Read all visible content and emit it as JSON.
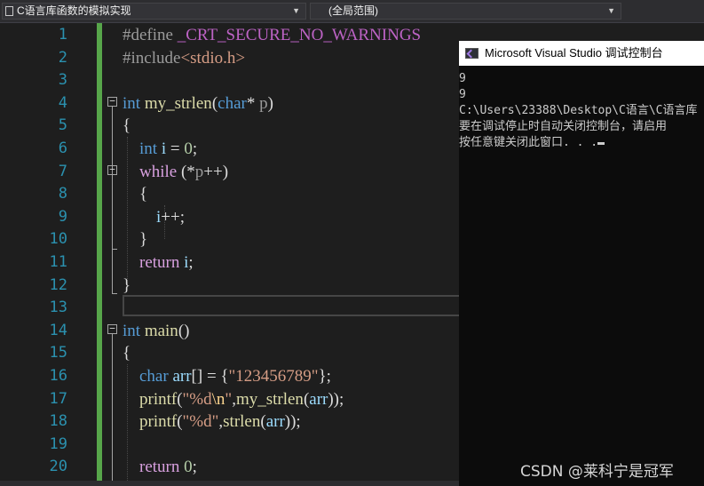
{
  "navbar": {
    "file_scope": "C语言库函数的模拟实现",
    "member_scope": "(全局范围)"
  },
  "editor": {
    "line_numbers": [
      "1",
      "2",
      "3",
      "4",
      "5",
      "6",
      "7",
      "8",
      "9",
      "10",
      "11",
      "12",
      "13",
      "14",
      "15",
      "16",
      "17",
      "18",
      "19",
      "20"
    ],
    "lines": [
      [
        {
          "t": "#define ",
          "c": "pp"
        },
        {
          "t": "_CRT_SECURE_NO_WARNINGS",
          "c": "macro"
        }
      ],
      [
        {
          "t": "#include",
          "c": "pp"
        },
        {
          "t": "<stdio.h>",
          "c": "str"
        }
      ],
      [],
      [
        {
          "t": "int",
          "c": "kw"
        },
        {
          "t": " "
        },
        {
          "t": "my_strlen",
          "c": "fn"
        },
        {
          "t": "("
        },
        {
          "t": "char",
          "c": "kw"
        },
        {
          "t": "* "
        },
        {
          "t": "p",
          "c": "param"
        },
        {
          "t": ")"
        }
      ],
      [
        {
          "t": "{"
        }
      ],
      [
        {
          "t": "    "
        },
        {
          "t": "int",
          "c": "kw"
        },
        {
          "t": " "
        },
        {
          "t": "i",
          "c": "var"
        },
        {
          "t": " = "
        },
        {
          "t": "0",
          "c": "num"
        },
        {
          "t": ";"
        }
      ],
      [
        {
          "t": "    "
        },
        {
          "t": "while",
          "c": "ctl"
        },
        {
          "t": " (*"
        },
        {
          "t": "p",
          "c": "param"
        },
        {
          "t": "++)"
        }
      ],
      [
        {
          "t": "    {"
        }
      ],
      [
        {
          "t": "        "
        },
        {
          "t": "i",
          "c": "var"
        },
        {
          "t": "++;"
        }
      ],
      [
        {
          "t": "    }"
        }
      ],
      [
        {
          "t": "    "
        },
        {
          "t": "return",
          "c": "ctl"
        },
        {
          "t": " "
        },
        {
          "t": "i",
          "c": "var"
        },
        {
          "t": ";"
        }
      ],
      [
        {
          "t": "}"
        }
      ],
      [],
      [
        {
          "t": "int",
          "c": "kw"
        },
        {
          "t": " "
        },
        {
          "t": "main",
          "c": "fn"
        },
        {
          "t": "()"
        }
      ],
      [
        {
          "t": "{"
        }
      ],
      [
        {
          "t": "    "
        },
        {
          "t": "char",
          "c": "kw"
        },
        {
          "t": " "
        },
        {
          "t": "arr",
          "c": "var"
        },
        {
          "t": "[] = {"
        },
        {
          "t": "\"123456789\"",
          "c": "str"
        },
        {
          "t": "};"
        }
      ],
      [
        {
          "t": "    "
        },
        {
          "t": "printf",
          "c": "fn"
        },
        {
          "t": "("
        },
        {
          "t": "\"%d",
          "c": "str"
        },
        {
          "t": "\\n",
          "c": "esc"
        },
        {
          "t": "\"",
          "c": "str"
        },
        {
          "t": ","
        },
        {
          "t": "my_strlen",
          "c": "fn"
        },
        {
          "t": "("
        },
        {
          "t": "arr",
          "c": "var"
        },
        {
          "t": "));"
        }
      ],
      [
        {
          "t": "    "
        },
        {
          "t": "printf",
          "c": "fn"
        },
        {
          "t": "("
        },
        {
          "t": "\"%d\"",
          "c": "str"
        },
        {
          "t": ","
        },
        {
          "t": "strlen",
          "c": "fn"
        },
        {
          "t": "("
        },
        {
          "t": "arr",
          "c": "var"
        },
        {
          "t": "));"
        }
      ],
      [],
      [
        {
          "t": "    "
        },
        {
          "t": "return",
          "c": "ctl"
        },
        {
          "t": " "
        },
        {
          "t": "0",
          "c": "num"
        },
        {
          "t": ";"
        }
      ]
    ]
  },
  "console": {
    "title": "Microsoft Visual Studio 调试控制台",
    "lines": [
      "9",
      "9",
      "C:\\Users\\23388\\Desktop\\C语言\\C语言库",
      "要在调试停止时自动关闭控制台，请启用",
      "按任意键关闭此窗口. . ."
    ]
  },
  "watermark": "CSDN @莱科宁是冠军"
}
